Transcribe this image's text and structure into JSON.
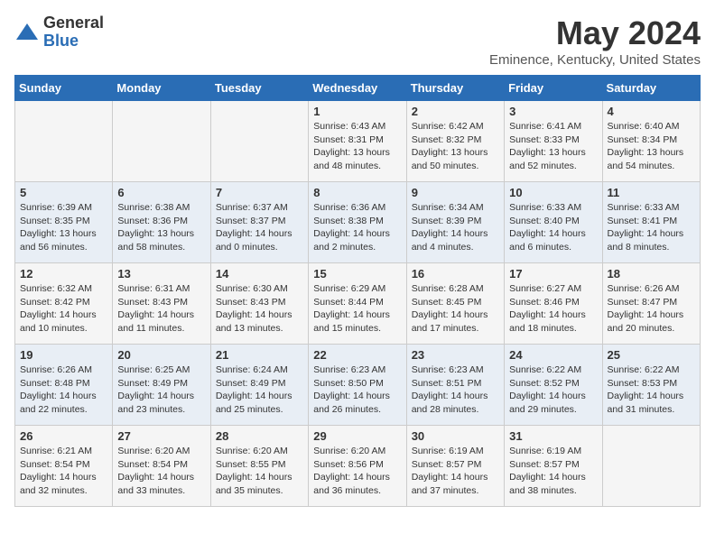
{
  "logo": {
    "general": "General",
    "blue": "Blue"
  },
  "title": "May 2024",
  "subtitle": "Eminence, Kentucky, United States",
  "headers": [
    "Sunday",
    "Monday",
    "Tuesday",
    "Wednesday",
    "Thursday",
    "Friday",
    "Saturday"
  ],
  "weeks": [
    [
      {
        "day": "",
        "info": ""
      },
      {
        "day": "",
        "info": ""
      },
      {
        "day": "",
        "info": ""
      },
      {
        "day": "1",
        "info": "Sunrise: 6:43 AM\nSunset: 8:31 PM\nDaylight: 13 hours\nand 48 minutes."
      },
      {
        "day": "2",
        "info": "Sunrise: 6:42 AM\nSunset: 8:32 PM\nDaylight: 13 hours\nand 50 minutes."
      },
      {
        "day": "3",
        "info": "Sunrise: 6:41 AM\nSunset: 8:33 PM\nDaylight: 13 hours\nand 52 minutes."
      },
      {
        "day": "4",
        "info": "Sunrise: 6:40 AM\nSunset: 8:34 PM\nDaylight: 13 hours\nand 54 minutes."
      }
    ],
    [
      {
        "day": "5",
        "info": "Sunrise: 6:39 AM\nSunset: 8:35 PM\nDaylight: 13 hours\nand 56 minutes."
      },
      {
        "day": "6",
        "info": "Sunrise: 6:38 AM\nSunset: 8:36 PM\nDaylight: 13 hours\nand 58 minutes."
      },
      {
        "day": "7",
        "info": "Sunrise: 6:37 AM\nSunset: 8:37 PM\nDaylight: 14 hours\nand 0 minutes."
      },
      {
        "day": "8",
        "info": "Sunrise: 6:36 AM\nSunset: 8:38 PM\nDaylight: 14 hours\nand 2 minutes."
      },
      {
        "day": "9",
        "info": "Sunrise: 6:34 AM\nSunset: 8:39 PM\nDaylight: 14 hours\nand 4 minutes."
      },
      {
        "day": "10",
        "info": "Sunrise: 6:33 AM\nSunset: 8:40 PM\nDaylight: 14 hours\nand 6 minutes."
      },
      {
        "day": "11",
        "info": "Sunrise: 6:33 AM\nSunset: 8:41 PM\nDaylight: 14 hours\nand 8 minutes."
      }
    ],
    [
      {
        "day": "12",
        "info": "Sunrise: 6:32 AM\nSunset: 8:42 PM\nDaylight: 14 hours\nand 10 minutes."
      },
      {
        "day": "13",
        "info": "Sunrise: 6:31 AM\nSunset: 8:43 PM\nDaylight: 14 hours\nand 11 minutes."
      },
      {
        "day": "14",
        "info": "Sunrise: 6:30 AM\nSunset: 8:43 PM\nDaylight: 14 hours\nand 13 minutes."
      },
      {
        "day": "15",
        "info": "Sunrise: 6:29 AM\nSunset: 8:44 PM\nDaylight: 14 hours\nand 15 minutes."
      },
      {
        "day": "16",
        "info": "Sunrise: 6:28 AM\nSunset: 8:45 PM\nDaylight: 14 hours\nand 17 minutes."
      },
      {
        "day": "17",
        "info": "Sunrise: 6:27 AM\nSunset: 8:46 PM\nDaylight: 14 hours\nand 18 minutes."
      },
      {
        "day": "18",
        "info": "Sunrise: 6:26 AM\nSunset: 8:47 PM\nDaylight: 14 hours\nand 20 minutes."
      }
    ],
    [
      {
        "day": "19",
        "info": "Sunrise: 6:26 AM\nSunset: 8:48 PM\nDaylight: 14 hours\nand 22 minutes."
      },
      {
        "day": "20",
        "info": "Sunrise: 6:25 AM\nSunset: 8:49 PM\nDaylight: 14 hours\nand 23 minutes."
      },
      {
        "day": "21",
        "info": "Sunrise: 6:24 AM\nSunset: 8:49 PM\nDaylight: 14 hours\nand 25 minutes."
      },
      {
        "day": "22",
        "info": "Sunrise: 6:23 AM\nSunset: 8:50 PM\nDaylight: 14 hours\nand 26 minutes."
      },
      {
        "day": "23",
        "info": "Sunrise: 6:23 AM\nSunset: 8:51 PM\nDaylight: 14 hours\nand 28 minutes."
      },
      {
        "day": "24",
        "info": "Sunrise: 6:22 AM\nSunset: 8:52 PM\nDaylight: 14 hours\nand 29 minutes."
      },
      {
        "day": "25",
        "info": "Sunrise: 6:22 AM\nSunset: 8:53 PM\nDaylight: 14 hours\nand 31 minutes."
      }
    ],
    [
      {
        "day": "26",
        "info": "Sunrise: 6:21 AM\nSunset: 8:54 PM\nDaylight: 14 hours\nand 32 minutes."
      },
      {
        "day": "27",
        "info": "Sunrise: 6:20 AM\nSunset: 8:54 PM\nDaylight: 14 hours\nand 33 minutes."
      },
      {
        "day": "28",
        "info": "Sunrise: 6:20 AM\nSunset: 8:55 PM\nDaylight: 14 hours\nand 35 minutes."
      },
      {
        "day": "29",
        "info": "Sunrise: 6:20 AM\nSunset: 8:56 PM\nDaylight: 14 hours\nand 36 minutes."
      },
      {
        "day": "30",
        "info": "Sunrise: 6:19 AM\nSunset: 8:57 PM\nDaylight: 14 hours\nand 37 minutes."
      },
      {
        "day": "31",
        "info": "Sunrise: 6:19 AM\nSunset: 8:57 PM\nDaylight: 14 hours\nand 38 minutes."
      },
      {
        "day": "",
        "info": ""
      }
    ]
  ]
}
